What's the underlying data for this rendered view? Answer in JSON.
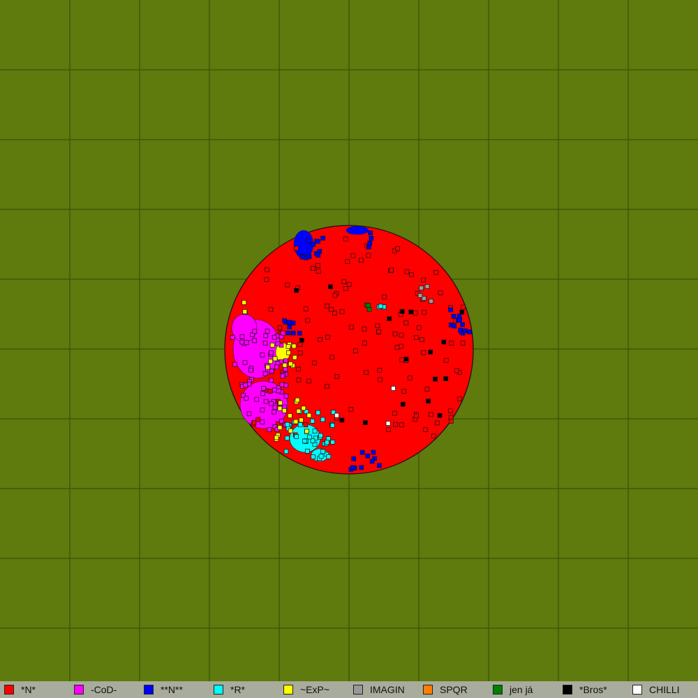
{
  "map": {
    "background_color": "#5f7a0d",
    "grid_color": "#2f4a08",
    "grid_divisions": 10
  },
  "legend": {
    "background_color": "#a8ac9c",
    "items": [
      {
        "label": "*N*",
        "color": "#ff0000"
      },
      {
        "label": "-CoD-",
        "color": "#ff00ff"
      },
      {
        "label": "**N**",
        "color": "#0000ff"
      },
      {
        "label": "*R*",
        "color": "#00ffff"
      },
      {
        "label": "~ExP~",
        "color": "#ffff00"
      },
      {
        "label": "IMAGIN",
        "color": "#999999"
      },
      {
        "label": "SPQR",
        "color": "#ff8000"
      },
      {
        "label": "jen já",
        "color": "#008000"
      },
      {
        "label": "*Bros*",
        "color": "#000000"
      },
      {
        "label": "CHILLI",
        "color": "#ffffff"
      }
    ]
  }
}
